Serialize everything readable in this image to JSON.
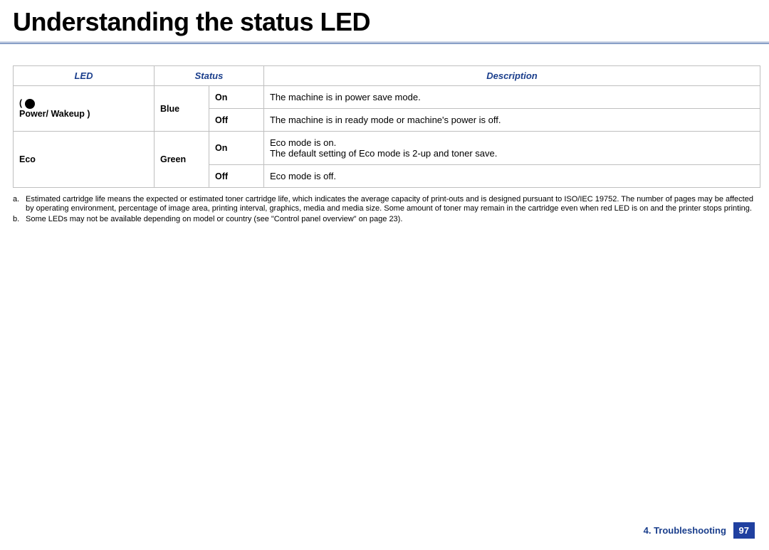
{
  "title": "Understanding the status LED",
  "table": {
    "headers": {
      "led": "LED",
      "status": "Status",
      "description": "Description"
    },
    "rows": [
      {
        "led_label": "Power/ Wakeup )",
        "color": "Blue",
        "states": [
          {
            "status": "On",
            "desc": "The machine is in power save mode."
          },
          {
            "status": "Off",
            "desc": "The machine is in ready mode or machine's power is off."
          }
        ]
      },
      {
        "led_label": "Eco",
        "color": "Green",
        "states": [
          {
            "status": "On",
            "desc_line1": "Eco mode is on.",
            "desc_line2": "The default setting of Eco mode is 2-up and toner save."
          },
          {
            "status": "Off",
            "desc": "Eco mode is off."
          }
        ]
      }
    ]
  },
  "footnotes": {
    "a": "Estimated cartridge life means the expected or estimated toner cartridge life, which indicates the average capacity of print-outs and is designed pursuant to ISO/IEC 19752. The number of pages may be affected by operating environment, percentage of image area, printing interval, graphics, media and media size. Some amount of toner may remain in the cartridge even when red LED is on and the printer stops printing.",
    "b": "Some LEDs may not be available depending on model or country (see \"Control panel overview\" on page 23)."
  },
  "footer": {
    "chapter": "4. Troubleshooting",
    "page": "97"
  }
}
